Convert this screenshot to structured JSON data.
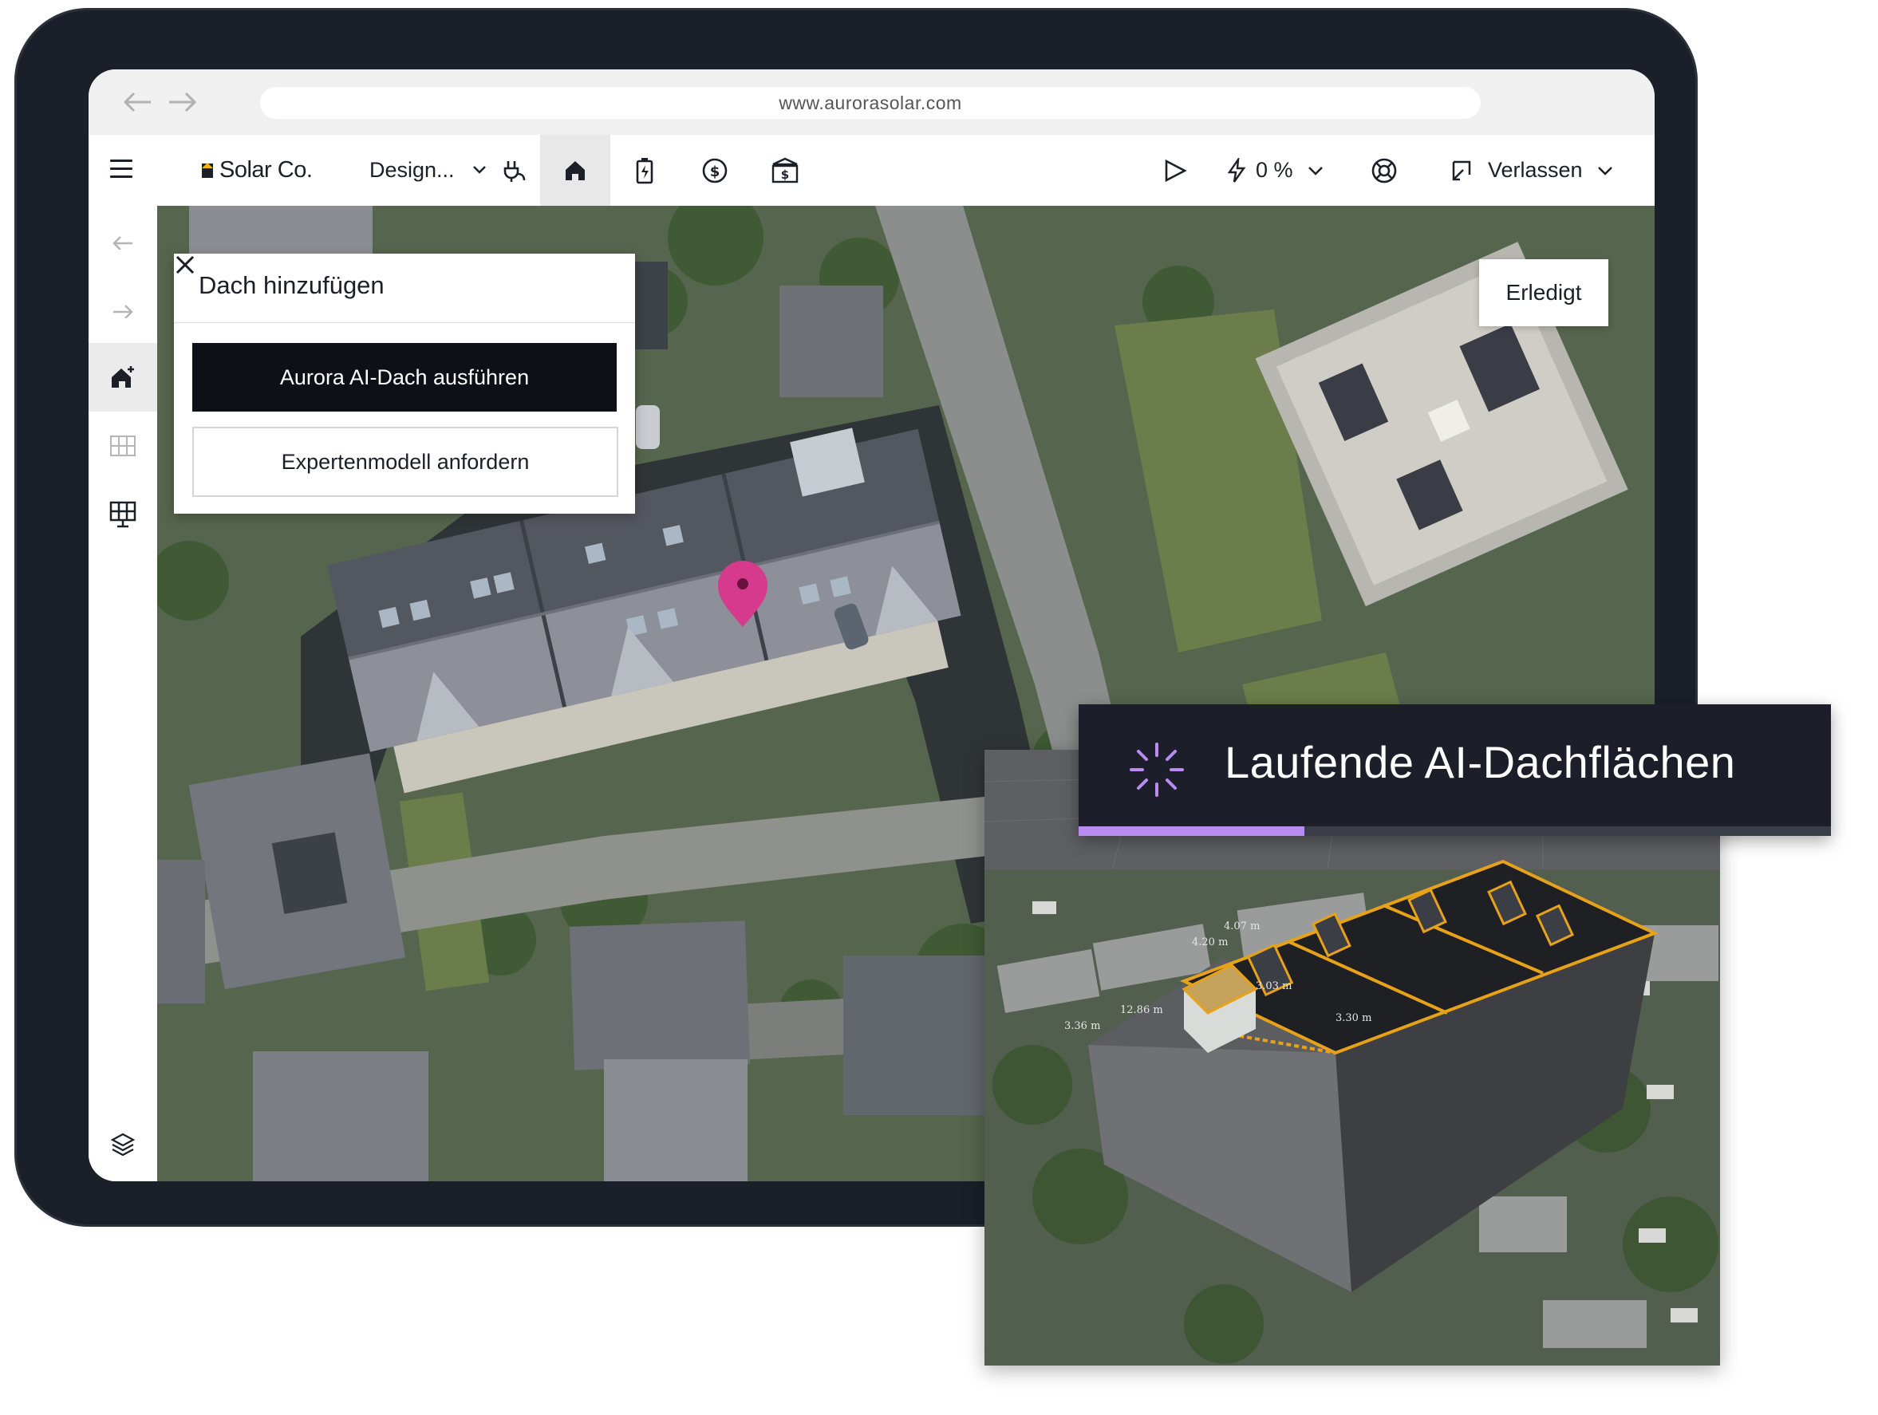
{
  "browser": {
    "url": "www.aurorasolar.com"
  },
  "appbar": {
    "logo_text": "Solar Co.",
    "design_label": "Design...",
    "energy_percent": "0 %",
    "exit_label": "Verlassen",
    "tools": [
      "plug-icon",
      "home-icon",
      "battery-icon",
      "dollar-icon",
      "financing-icon"
    ],
    "active_tool": "home-icon"
  },
  "sidebar": {
    "items": [
      "undo-icon",
      "redo-icon",
      "add-roof-icon",
      "grid-icon",
      "solar-panel-icon",
      "layers-icon"
    ],
    "active_item": "add-roof-icon"
  },
  "popup": {
    "title": "Dach hinzufügen",
    "primary_button": "Aurora AI-Dach ausführen",
    "secondary_button": "Expertenmodell anfordern"
  },
  "map": {
    "done_button": "Erledigt",
    "pin_color": "#d63a8c"
  },
  "ai_status": {
    "text": "Laufende AI-Dachflächen",
    "progress": 0.3,
    "accent_color": "#b88cf0"
  },
  "model_labels": [
    "4.07 m",
    "4.20 m",
    "12.86 m",
    "3.03 m",
    "3.36 m",
    "3.30 m"
  ],
  "colors": {
    "frame": "#1a1f29",
    "primary_button": "#0d1017",
    "roof_outline": "#e8a21a"
  }
}
